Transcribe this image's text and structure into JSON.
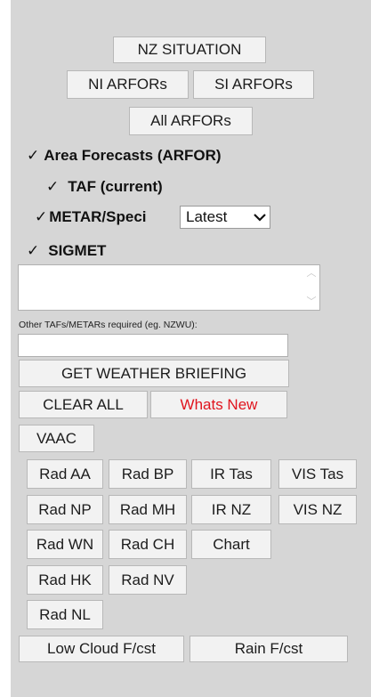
{
  "top_buttons": {
    "nz_situation": "NZ SITUATION",
    "ni_arfors": "NI ARFORs",
    "si_arfors": "SI ARFORs",
    "all_arfors": "All ARFORs"
  },
  "checkboxes": {
    "area_forecasts": {
      "label": "Area Forecasts (ARFOR)",
      "checked": true
    },
    "taf": {
      "label": "TAF (current)",
      "checked": true
    },
    "metar": {
      "label": "METAR/Speci",
      "checked": true
    },
    "sigmet": {
      "label": "SIGMET",
      "checked": true
    }
  },
  "metar_select": {
    "value": "Latest"
  },
  "tick_glyph": "✓",
  "other_label": "Other TAFs/METARs required (eg. NZWU):",
  "actions": {
    "get_briefing": "GET WEATHER BRIEFING",
    "clear_all": "CLEAR ALL",
    "whats_new": "Whats New",
    "vaac": "VAAC"
  },
  "grid_buttons": {
    "rad_aa": "Rad AA",
    "rad_bp": "Rad BP",
    "ir_tas": "IR Tas",
    "vis_tas": "VIS Tas",
    "rad_np": "Rad NP",
    "rad_mh": "Rad MH",
    "ir_nz": "IR NZ",
    "vis_nz": "VIS NZ",
    "rad_wn": "Rad WN",
    "rad_ch": "Rad CH",
    "chart": "Chart",
    "rad_hk": "Rad HK",
    "rad_nv": "Rad NV",
    "rad_nl": "Rad NL"
  },
  "bottom_buttons": {
    "low_cloud": "Low Cloud F/cst",
    "rain": "Rain F/cst"
  },
  "colors": {
    "panel": "#d6d6d6",
    "button": "#f2f2f2",
    "whats_new": "#e0141e"
  }
}
